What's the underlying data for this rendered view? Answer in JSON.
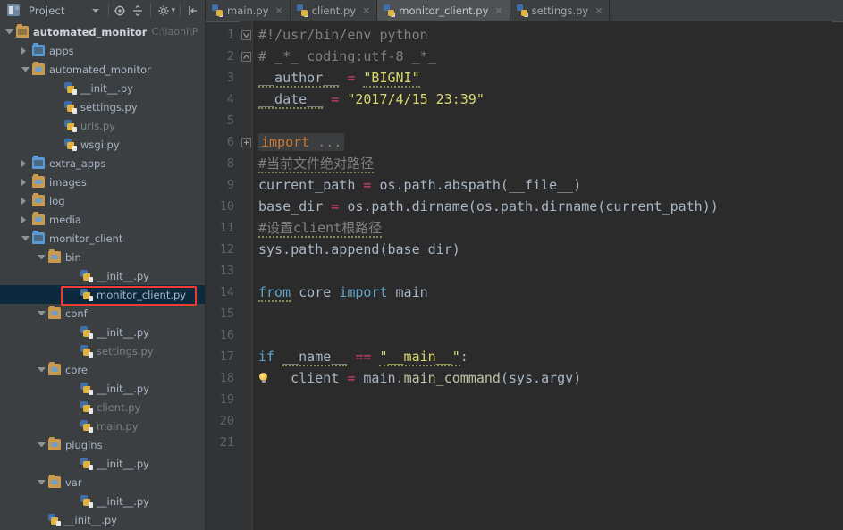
{
  "window": {
    "accent_selection": "#0d293e",
    "annotation_color": "#ef3b32",
    "panel_bg": "#3c3f41",
    "editor_bg": "#2b2b2b"
  },
  "project_panel": {
    "title": "Project",
    "panel_icon": "project-panel-icon",
    "dropdown_icon": "chevron-down-icon",
    "toolbar": [
      {
        "name": "locate-in-tree-icon",
        "label": ""
      },
      {
        "name": "collapse-all-icon",
        "label": ""
      },
      {
        "name": "settings-gear-icon",
        "label": ""
      },
      {
        "name": "hide-panel-icon",
        "label": ""
      }
    ]
  },
  "tabs": [
    {
      "label": "main.py",
      "active": false,
      "close": "×"
    },
    {
      "label": "client.py",
      "active": false,
      "close": "×"
    },
    {
      "label": "monitor_client.py",
      "active": true,
      "close": "×"
    },
    {
      "label": "settings.py",
      "active": false,
      "close": "×"
    }
  ],
  "tree": {
    "root_path": "C:\\laoni\\P",
    "nodes": [
      {
        "label": "automated_monitor",
        "indent": 0,
        "arrow": "open",
        "icon": "folder-root",
        "style": "root",
        "selected": false
      },
      {
        "label": "apps",
        "indent": 1,
        "arrow": "closed",
        "icon": "folder-blue",
        "style": "normal",
        "selected": false
      },
      {
        "label": "automated_monitor",
        "indent": 1,
        "arrow": "open",
        "icon": "folder-orange",
        "style": "normal",
        "selected": false
      },
      {
        "label": "__init__.py",
        "indent": 3,
        "arrow": "none",
        "icon": "py",
        "style": "normal",
        "selected": false
      },
      {
        "label": "settings.py",
        "indent": 3,
        "arrow": "none",
        "icon": "py",
        "style": "normal",
        "selected": false
      },
      {
        "label": "urls.py",
        "indent": 3,
        "arrow": "none",
        "icon": "py",
        "style": "dim",
        "selected": false
      },
      {
        "label": "wsgi.py",
        "indent": 3,
        "arrow": "none",
        "icon": "py",
        "style": "normal",
        "selected": false
      },
      {
        "label": "extra_apps",
        "indent": 1,
        "arrow": "closed",
        "icon": "folder-blue",
        "style": "normal",
        "selected": false
      },
      {
        "label": "images",
        "indent": 1,
        "arrow": "closed",
        "icon": "folder-orange",
        "style": "normal",
        "selected": false
      },
      {
        "label": "log",
        "indent": 1,
        "arrow": "closed",
        "icon": "folder-orange",
        "style": "normal",
        "selected": false
      },
      {
        "label": "media",
        "indent": 1,
        "arrow": "closed",
        "icon": "folder-orange",
        "style": "normal",
        "selected": false
      },
      {
        "label": "monitor_client",
        "indent": 1,
        "arrow": "open",
        "icon": "folder-blue",
        "style": "normal",
        "selected": false
      },
      {
        "label": "bin",
        "indent": 2,
        "arrow": "open",
        "icon": "folder-orange",
        "style": "normal",
        "selected": false
      },
      {
        "label": "__init__.py",
        "indent": 4,
        "arrow": "none",
        "icon": "py",
        "style": "normal",
        "selected": false
      },
      {
        "label": "monitor_client.py",
        "indent": 4,
        "arrow": "none",
        "icon": "py",
        "style": "normal",
        "selected": true
      },
      {
        "label": "conf",
        "indent": 2,
        "arrow": "open",
        "icon": "folder-orange",
        "style": "normal",
        "selected": false
      },
      {
        "label": "__init__.py",
        "indent": 4,
        "arrow": "none",
        "icon": "py",
        "style": "normal",
        "selected": false
      },
      {
        "label": "settings.py",
        "indent": 4,
        "arrow": "none",
        "icon": "py",
        "style": "dim",
        "selected": false
      },
      {
        "label": "core",
        "indent": 2,
        "arrow": "open",
        "icon": "folder-orange",
        "style": "normal",
        "selected": false
      },
      {
        "label": "__init__.py",
        "indent": 4,
        "arrow": "none",
        "icon": "py",
        "style": "normal",
        "selected": false
      },
      {
        "label": "client.py",
        "indent": 4,
        "arrow": "none",
        "icon": "py",
        "style": "dim",
        "selected": false
      },
      {
        "label": "main.py",
        "indent": 4,
        "arrow": "none",
        "icon": "py",
        "style": "dim",
        "selected": false
      },
      {
        "label": "plugins",
        "indent": 2,
        "arrow": "open",
        "icon": "folder-orange",
        "style": "normal",
        "selected": false
      },
      {
        "label": "__init__.py",
        "indent": 4,
        "arrow": "none",
        "icon": "py",
        "style": "normal",
        "selected": false
      },
      {
        "label": "var",
        "indent": 2,
        "arrow": "open",
        "icon": "folder-orange",
        "style": "normal",
        "selected": false
      },
      {
        "label": "__init__.py",
        "indent": 4,
        "arrow": "none",
        "icon": "py",
        "style": "normal",
        "selected": false
      },
      {
        "label": "__init__.py",
        "indent": 2,
        "arrow": "none",
        "icon": "py",
        "style": "normal",
        "selected": false
      }
    ]
  },
  "editor": {
    "file": "monitor_client.py",
    "line_numbers": [
      "1",
      "2",
      "3",
      "4",
      "5",
      "6",
      "8",
      "9",
      "10",
      "11",
      "12",
      "13",
      "14",
      "15",
      "16",
      "17",
      "18",
      "19",
      "20",
      "21"
    ],
    "fold_markers": [
      {
        "line": "1",
        "type": "fold-end-down"
      },
      {
        "line": "2",
        "type": "fold-end-up"
      },
      {
        "line": "6",
        "type": "expand-plus"
      }
    ],
    "bulb_line": "18",
    "lines": [
      {
        "n": "1",
        "text": "#!/usr/bin/env python"
      },
      {
        "n": "2",
        "text": "# _*_ coding:utf-8 _*_"
      },
      {
        "n": "3",
        "text": "__author__ = \"BIGNI\""
      },
      {
        "n": "4",
        "text": "__date__ = \"2017/4/15 23:39\""
      },
      {
        "n": "5",
        "text": ""
      },
      {
        "n": "6",
        "text": "import ..."
      },
      {
        "n": "8",
        "text": "#当前文件绝对路径"
      },
      {
        "n": "9",
        "text": "current_path = os.path.abspath(__file__)"
      },
      {
        "n": "10",
        "text": "base_dir = os.path.dirname(os.path.dirname(current_path))"
      },
      {
        "n": "11",
        "text": "#设置client根路径"
      },
      {
        "n": "12",
        "text": "sys.path.append(base_dir)"
      },
      {
        "n": "13",
        "text": ""
      },
      {
        "n": "14",
        "text": "from core import main"
      },
      {
        "n": "15",
        "text": ""
      },
      {
        "n": "16",
        "text": ""
      },
      {
        "n": "17",
        "text": "if __name__ == \"__main__\":"
      },
      {
        "n": "18",
        "text": "    client = main.main_command(sys.argv)"
      },
      {
        "n": "19",
        "text": ""
      },
      {
        "n": "20",
        "text": ""
      },
      {
        "n": "21",
        "text": ""
      }
    ],
    "tokens": {
      "line1": {
        "comment": "#!/usr/bin/env python"
      },
      "line2": {
        "comment": "# _*_ coding:utf-8 _*_"
      },
      "line3": {
        "var": "__author__",
        "op": "=",
        "str": "\"BIGNI\""
      },
      "line4": {
        "var": "__date__",
        "op": "=",
        "str": "\"2017/4/15 23:39\""
      },
      "line6": {
        "kw": "import",
        "ellipsis": "..."
      },
      "line8": {
        "comment": "#当前文件绝对路径"
      },
      "line9": {
        "var": "current_path",
        "op": "=",
        "expr": "os.path.abspath(__file__)"
      },
      "line10": {
        "var": "base_dir",
        "op": "=",
        "expr": "os.path.dirname(os.path.dirname(current_path))"
      },
      "line11": {
        "comment": "#设置client根路径"
      },
      "line12": {
        "expr": "sys.path.append(base_dir)"
      },
      "line14": {
        "kw": "from",
        "mod": "core",
        "kw2": "import",
        "name": "main"
      },
      "line17": {
        "kw": "if",
        "var": "__name__",
        "op": "==",
        "str": "\"__main__\"",
        "colon": ":"
      },
      "line18": {
        "var": "client",
        "op": "=",
        "obj": "main.",
        "fn": "main_command",
        "args": "(sys.argv)"
      }
    }
  }
}
